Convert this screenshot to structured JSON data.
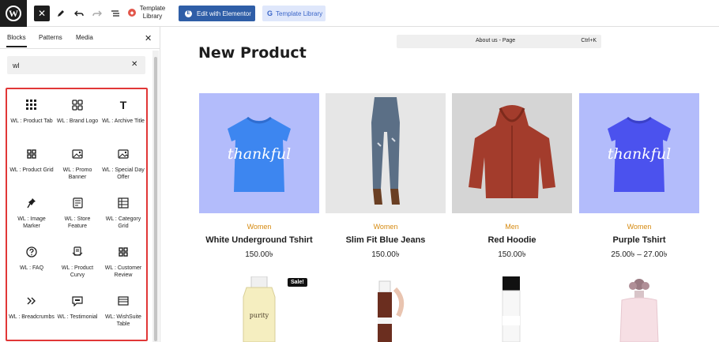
{
  "toolbar": {
    "template_library_text": "Template Library",
    "edit_elementor_label": "Edit with Elementor",
    "template_library_button_label": "Template Library"
  },
  "sidebar": {
    "tabs": [
      "Blocks",
      "Patterns",
      "Media"
    ],
    "search_value": "wl",
    "blocks": [
      {
        "label": "WL : Product Tab",
        "icon": "grid-dots-icon"
      },
      {
        "label": "WL : Brand Logo",
        "icon": "squares-icon"
      },
      {
        "label": "WL : Archive Title",
        "icon": "title-icon"
      },
      {
        "label": "WL : Product Grid",
        "icon": "grid-icon"
      },
      {
        "label": "WL : Promo Banner",
        "icon": "image-icon"
      },
      {
        "label": "WL : Special Day Offer",
        "icon": "image-icon"
      },
      {
        "label": "WL : Image Marker",
        "icon": "pin-icon"
      },
      {
        "label": "WL : Store Feature",
        "icon": "feature-icon"
      },
      {
        "label": "WL : Category Grid",
        "icon": "table-icon"
      },
      {
        "label": "WL : FAQ",
        "icon": "question-icon"
      },
      {
        "label": "WL : Product Curvy",
        "icon": "curvy-icon"
      },
      {
        "label": "WL : Customer Review",
        "icon": "grid-icon"
      },
      {
        "label": "WL : Breadcrumbs",
        "icon": "breadcrumb-icon"
      },
      {
        "label": "WL : Testimonial",
        "icon": "testimonial-icon"
      },
      {
        "label": "WL: WishSuite Table",
        "icon": "wishsuite-table-icon"
      }
    ]
  },
  "canvas": {
    "command_title": "About us - Page",
    "command_shortcut": "Ctrl+K",
    "page_title": "New Product",
    "products": [
      {
        "category": "Women",
        "name": "White Underground Tshirt",
        "price": "150.00৳",
        "bg": "#b3bcfb",
        "shirt": "#3d86f0",
        "art": "thankful-shirt"
      },
      {
        "category": "Women",
        "name": "Slim Fit Blue Jeans",
        "price": "150.00৳",
        "bg": "#e6e6e6",
        "art": "jeans"
      },
      {
        "category": "Men",
        "name": "Red Hoodie",
        "price": "150.00৳",
        "bg": "#d5d5d5",
        "art": "hoodie"
      },
      {
        "category": "Women",
        "name": "Purple Tshirt",
        "price": "25.00৳ – 27.00৳",
        "bg": "#b3bcfb",
        "shirt": "#4b52ee",
        "art": "thankful-shirt"
      }
    ],
    "shirt_text": "thankful",
    "sale_badge": "Sale!",
    "bottle_label": "purity"
  },
  "colors": {
    "accent": "#2f5ea7",
    "category": "#d68a10",
    "highlight_border": "#e13737"
  }
}
